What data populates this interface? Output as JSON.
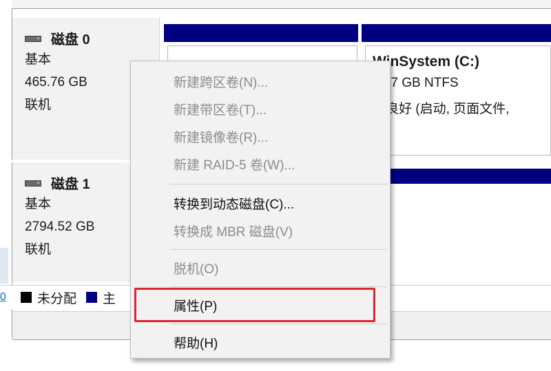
{
  "disks": [
    {
      "name": "磁盘 0",
      "type": "基本",
      "size": "465.76 GB",
      "status": "联机"
    },
    {
      "name": "磁盘 1",
      "type": "基本",
      "size": "2794.52 GB",
      "status": "联机"
    }
  ],
  "volume": {
    "title": "WinSystem  (C:)",
    "size": "5.57 GB NTFS",
    "status": "态良好 (启动, 页面文件, "
  },
  "legend": {
    "edge_text": "0",
    "unallocated": "未分配",
    "primary": "主"
  },
  "context_menu": {
    "items": [
      {
        "label": "新建跨区卷(N)...",
        "enabled": false
      },
      {
        "label": "新建带区卷(T)...",
        "enabled": false
      },
      {
        "label": "新建镜像卷(R)...",
        "enabled": false
      },
      {
        "label": "新建 RAID-5 卷(W)...",
        "enabled": false
      },
      {
        "label": "转换到动态磁盘(C)...",
        "enabled": true
      },
      {
        "label": "转换成 MBR 磁盘(V)",
        "enabled": false
      },
      {
        "label": "脱机(O)",
        "enabled": false
      },
      {
        "label": "属性(P)",
        "enabled": true,
        "highlighted": true
      },
      {
        "label": "帮助(H)",
        "enabled": true
      }
    ]
  },
  "colors": {
    "partition_bar": "#000080",
    "unallocated_swatch": "#000000",
    "primary_swatch": "#000080",
    "highlight_box": "#e4202e"
  }
}
